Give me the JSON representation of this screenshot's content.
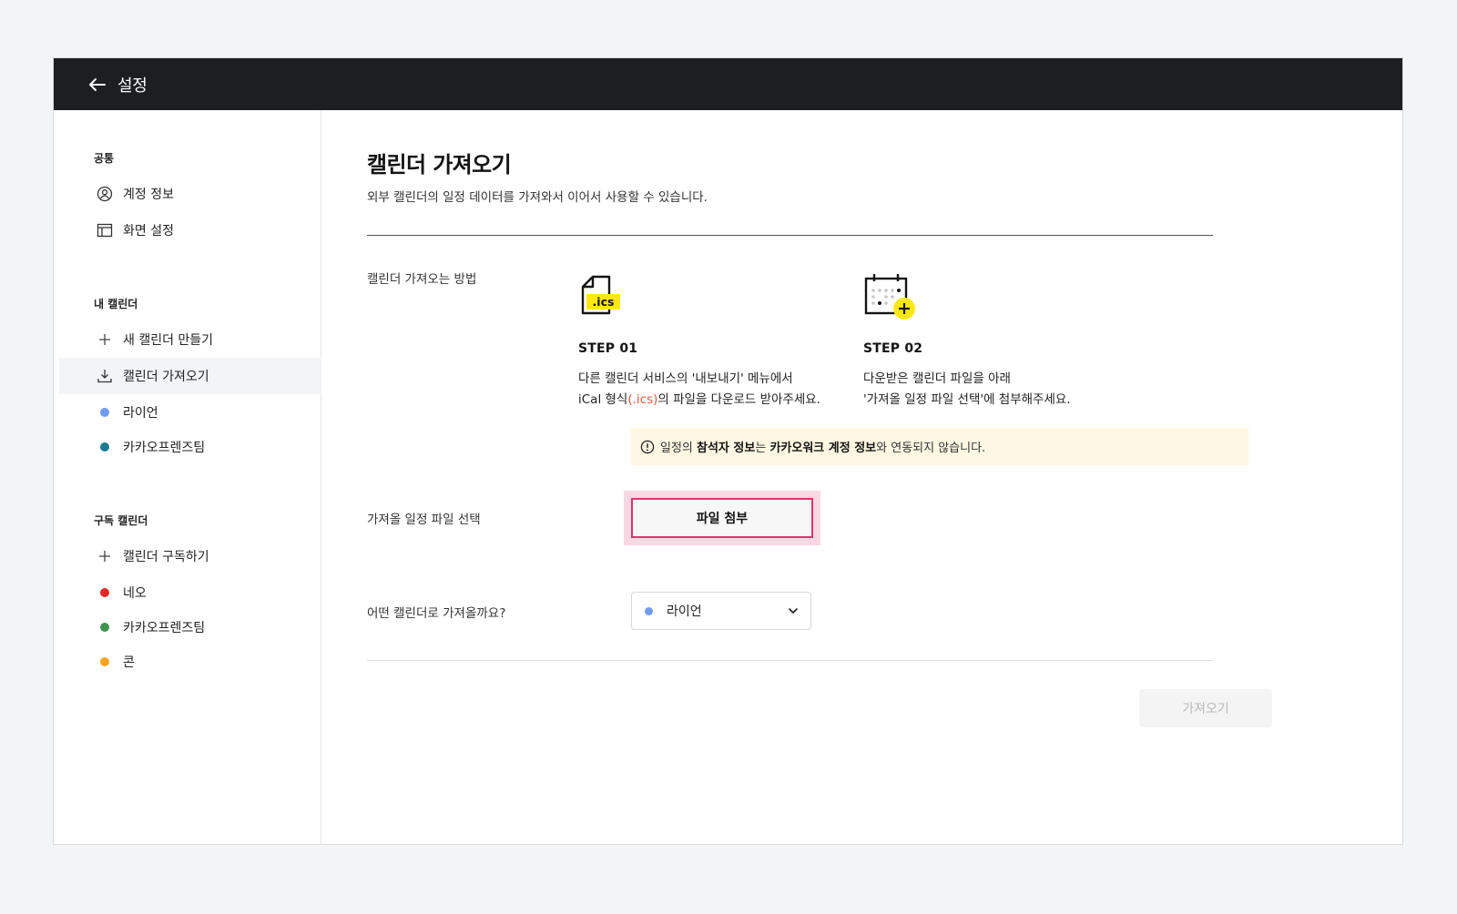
{
  "header": {
    "title": "설정"
  },
  "sidebar": {
    "groups": [
      {
        "title": "공통",
        "items": [
          {
            "label": "계정 정보",
            "icon": "account-icon"
          },
          {
            "label": "화면 설정",
            "icon": "layout-icon"
          }
        ]
      },
      {
        "title": "내 캘린더",
        "items": [
          {
            "label": "새 캘린더 만들기",
            "icon": "plus-icon"
          },
          {
            "label": "캘린더 가져오기",
            "icon": "download-icon",
            "active": true
          },
          {
            "label": "라이언",
            "color": "#6f9cf0"
          },
          {
            "label": "카카오프렌즈팀",
            "color": "#1b7a8f"
          }
        ]
      },
      {
        "title": "구독 캘린더",
        "items": [
          {
            "label": "캘린더 구독하기",
            "icon": "plus-icon"
          },
          {
            "label": "네오",
            "color": "#e32727"
          },
          {
            "label": "카카오프렌즈팀",
            "color": "#3f9450"
          },
          {
            "label": "콘",
            "color": "#f4a621"
          }
        ]
      }
    ]
  },
  "main": {
    "title": "캘린더 가져오기",
    "description": "외부 캘린더의 일정 데이터를 가져와서 이어서 사용할 수 있습니다.",
    "method_label": "캘린더 가져오는 방법",
    "steps": [
      {
        "title": "STEP 01",
        "icon_text": ".ics",
        "line1": "다른 캘린더 서비스의 '내보내기' 메뉴에서",
        "line2_a": "iCal 형식",
        "line2_hl": "(.ics)",
        "line2_b": "의 파일을 다운로드 받아주세요."
      },
      {
        "title": "STEP 02",
        "line1": "다운받은 캘린더 파일을 아래",
        "line2": "'가져올 일정 파일 선택'에 첨부해주세요."
      }
    ],
    "notice": {
      "p1": "일정의 ",
      "b1": "참석자 정보",
      "p2": "는 ",
      "b2": "카카오워크 계정 정보",
      "p3": "와 연동되지 않습니다."
    },
    "file_label": "가져올 일정 파일 선택",
    "attach_button": "파일 첨부",
    "target_label": "어떤 캘린더로 가져올까요?",
    "target_select": {
      "value": "라이언",
      "color": "#6f9cf0"
    },
    "import_button": "가져오기"
  },
  "colors": {
    "header_bg": "#1d1e20",
    "highlight": "#e0573f",
    "attach_border": "#e0346e",
    "notice_bg": "#fef7e3",
    "icon_yellow": "#ffe812"
  }
}
